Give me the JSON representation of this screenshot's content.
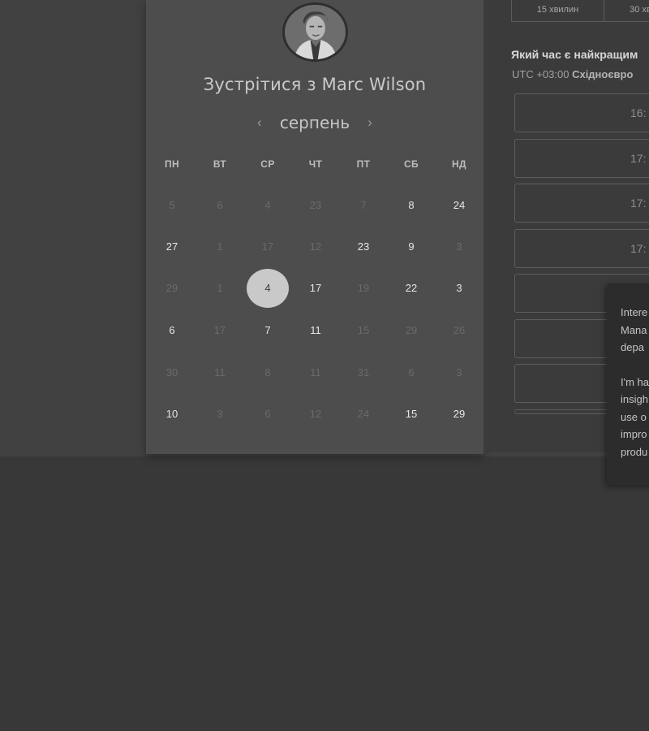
{
  "host": {
    "meeting_title": "Зустрітися з Marc Wilson"
  },
  "calendar": {
    "month": "серпень",
    "weekdays": [
      "ПН",
      "ВТ",
      "СР",
      "ЧТ",
      "ПТ",
      "СБ",
      "НД"
    ],
    "rows": [
      [
        {
          "d": "5",
          "s": "dim"
        },
        {
          "d": "6",
          "s": "dim"
        },
        {
          "d": "4",
          "s": "dim"
        },
        {
          "d": "23",
          "s": "dim"
        },
        {
          "d": "7",
          "s": "dim"
        },
        {
          "d": "8",
          "s": "avail"
        },
        {
          "d": "24",
          "s": "avail"
        }
      ],
      [
        {
          "d": "27",
          "s": "avail"
        },
        {
          "d": "1",
          "s": "dim"
        },
        {
          "d": "17",
          "s": "dim"
        },
        {
          "d": "12",
          "s": "dim"
        },
        {
          "d": "23",
          "s": "avail"
        },
        {
          "d": "9",
          "s": "avail"
        },
        {
          "d": "3",
          "s": "dim"
        }
      ],
      [
        {
          "d": "29",
          "s": "dim"
        },
        {
          "d": "1",
          "s": "dim"
        },
        {
          "d": "4",
          "s": "selected"
        },
        {
          "d": "17",
          "s": "avail"
        },
        {
          "d": "19",
          "s": "dim"
        },
        {
          "d": "22",
          "s": "avail"
        },
        {
          "d": "3",
          "s": "avail"
        }
      ],
      [
        {
          "d": "6",
          "s": "avail"
        },
        {
          "d": "17",
          "s": "dim"
        },
        {
          "d": "7",
          "s": "avail"
        },
        {
          "d": "11",
          "s": "avail"
        },
        {
          "d": "15",
          "s": "dim"
        },
        {
          "d": "29",
          "s": "dim"
        },
        {
          "d": "26",
          "s": "dim"
        }
      ],
      [
        {
          "d": "30",
          "s": "dim"
        },
        {
          "d": "11",
          "s": "dim"
        },
        {
          "d": "8",
          "s": "dim"
        },
        {
          "d": "11",
          "s": "dim"
        },
        {
          "d": "31",
          "s": "dim"
        },
        {
          "d": "6",
          "s": "dim"
        },
        {
          "d": "3",
          "s": "dim"
        }
      ],
      [
        {
          "d": "10",
          "s": "avail"
        },
        {
          "d": "3",
          "s": "dim"
        },
        {
          "d": "6",
          "s": "dim"
        },
        {
          "d": "12",
          "s": "dim"
        },
        {
          "d": "24",
          "s": "dim"
        },
        {
          "d": "15",
          "s": "avail"
        },
        {
          "d": "29",
          "s": "avail"
        }
      ]
    ]
  },
  "durations": [
    {
      "label": "15 хвилин"
    },
    {
      "label": "30 хв"
    }
  ],
  "schedule": {
    "best_time_heading": "Який час є найкращим",
    "timezone_utc": "UTC +03:00",
    "timezone_name": "Східноєвро",
    "slots": [
      "16:",
      "17:",
      "17:",
      "17:",
      "",
      "",
      "",
      ""
    ]
  },
  "tooltip": {
    "lines_1": [
      "Intere",
      "Mana",
      "depa"
    ],
    "lines_2": [
      "I'm ha",
      "insigh",
      "use o",
      "impro",
      "produ"
    ]
  },
  "colors": {
    "page_bg": "#383838",
    "card_bg": "#4d4d4d",
    "selected_day": "#c9c9c9"
  }
}
